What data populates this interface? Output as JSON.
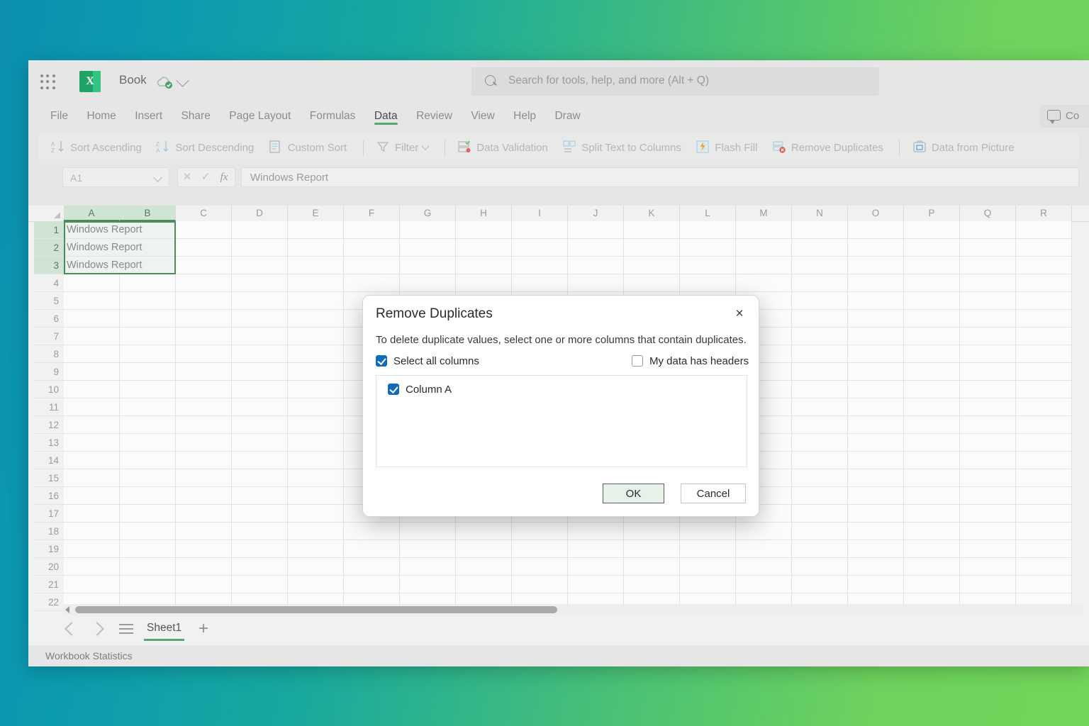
{
  "titlebar": {
    "app_icon": "excel-icon",
    "app_launcher": "app-launcher-icon",
    "book_name": "Book",
    "autosave_cloud": "cloud-saved-icon",
    "title_chevron": "chevron-down-icon"
  },
  "search": {
    "icon": "search-icon",
    "placeholder": "Search for tools, help, and more (Alt + Q)"
  },
  "ribbon": {
    "tabs": [
      {
        "label": "File",
        "active": false
      },
      {
        "label": "Home",
        "active": false
      },
      {
        "label": "Insert",
        "active": false
      },
      {
        "label": "Share",
        "active": false
      },
      {
        "label": "Page Layout",
        "active": false
      },
      {
        "label": "Formulas",
        "active": false
      },
      {
        "label": "Data",
        "active": true
      },
      {
        "label": "Review",
        "active": false
      },
      {
        "label": "View",
        "active": false
      },
      {
        "label": "Help",
        "active": false
      },
      {
        "label": "Draw",
        "active": false
      }
    ],
    "comments_label": "Co",
    "comments_icon": "comment-icon"
  },
  "commandbar": {
    "items": [
      {
        "label": "Sort Ascending",
        "icon": "sort-ascending-icon",
        "caret": false
      },
      {
        "label": "Sort Descending",
        "icon": "sort-descending-icon",
        "caret": false
      },
      {
        "label": "Custom Sort",
        "icon": "custom-sort-icon",
        "caret": false
      },
      {
        "label": "Filter",
        "icon": "filter-icon",
        "caret": true
      },
      {
        "label": "Data Validation",
        "icon": "data-validation-icon",
        "caret": false
      },
      {
        "label": "Split Text to Columns",
        "icon": "split-text-icon",
        "caret": false
      },
      {
        "label": "Flash Fill",
        "icon": "flash-fill-icon",
        "caret": false
      },
      {
        "label": "Remove Duplicates",
        "icon": "remove-duplicates-icon",
        "caret": false
      },
      {
        "label": "Data from Picture",
        "icon": "data-from-picture-icon",
        "caret": false
      }
    ]
  },
  "formulabar": {
    "namebox_value": "A1",
    "cancel_icon": "cancel-x-icon",
    "enter_icon": "confirm-check-icon",
    "function_icon": "fx",
    "formula_value": "Windows Report"
  },
  "grid": {
    "columns": [
      "A",
      "B",
      "C",
      "D",
      "E",
      "F",
      "G",
      "H",
      "I",
      "J",
      "K",
      "L",
      "M",
      "N",
      "O",
      "P",
      "Q",
      "R"
    ],
    "selected_columns": [
      "A",
      "B"
    ],
    "rows": [
      1,
      2,
      3,
      4,
      5,
      6,
      7,
      8,
      9,
      10,
      11,
      12,
      13,
      14,
      15,
      16,
      17,
      18,
      19,
      20,
      21,
      22
    ],
    "selected_rows": [
      1,
      2,
      3
    ],
    "cell_values": [
      {
        "row": 1,
        "col": "A",
        "value": "Windows Report"
      },
      {
        "row": 2,
        "col": "A",
        "value": "Windows Report"
      },
      {
        "row": 3,
        "col": "A",
        "value": "Windows Report"
      }
    ],
    "selection_range": "A1:B3"
  },
  "bottom": {
    "prev_sheet": "chevron-left-icon",
    "next_sheet": "chevron-right-icon",
    "all_sheets": "sheet-list-icon",
    "sheet_tabs": [
      {
        "label": "Sheet1",
        "active": true
      }
    ],
    "add_sheet": "+",
    "status_text": "Workbook Statistics"
  },
  "dialog": {
    "title": "Remove Duplicates",
    "close_label": "×",
    "description": "To delete duplicate values, select one or more columns that contain duplicates.",
    "select_all_label": "Select all columns",
    "select_all_checked": true,
    "headers_label": "My data has headers",
    "headers_checked": false,
    "columns": [
      {
        "label": "Column A",
        "checked": true
      }
    ],
    "ok_label": "OK",
    "cancel_label": "Cancel"
  },
  "colors": {
    "accent_green": "#5aa46f",
    "checkbox_blue": "#0f6cbd",
    "selection_green": "#cfe4d3",
    "bg_left": "#0b8fb0",
    "bg_right": "#72d65a"
  }
}
